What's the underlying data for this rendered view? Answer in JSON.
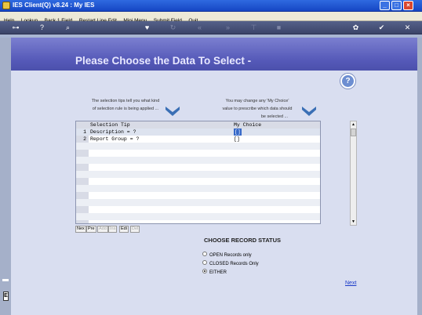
{
  "window": {
    "title": "IES Client(Q) v8.24 : My IES"
  },
  "menu": [
    "Help",
    "Lookup",
    "Back 1 Field",
    "Restart Line Edit",
    "Mini Menu",
    "Submit Field",
    "Quit"
  ],
  "toolbar_icons": [
    "key-icon",
    "help-icon",
    "search-icon",
    "heart-icon",
    "refresh-icon",
    "rewind-icon",
    "fast-forward-icon",
    "tool-icon",
    "stop-icon",
    "settings-icon",
    "check-icon",
    "close-icon"
  ],
  "banner": {
    "heading": "Please Choose the Data To Select -"
  },
  "tips": {
    "left_line1": "The selection tips tell you what kind",
    "left_line2": "of selection rule is being applied ...",
    "right_line1": "You may change any 'My Choice'",
    "right_line2": "value to prescribe which data should",
    "right_line3": "be selected ..."
  },
  "grid": {
    "columns": [
      "Selection Tip",
      "My Choice"
    ],
    "rows": [
      {
        "num": "1",
        "tip": "Description = ?",
        "choice": "[]"
      },
      {
        "num": "2",
        "tip": " Report Group = ?",
        "choice": "[]"
      }
    ],
    "buttons": [
      {
        "label": "Nex",
        "enabled": true
      },
      {
        "label": "Pre",
        "enabled": true
      },
      {
        "label": "Add",
        "enabled": false
      },
      {
        "label": "Ins",
        "enabled": false
      },
      {
        "label": "Edi",
        "enabled": true
      },
      {
        "label": "Del",
        "enabled": false
      }
    ]
  },
  "record_status": {
    "title": "CHOOSE RECORD STATUS",
    "options": [
      "OPEN Records only",
      "CLOSED Records Only",
      "EITHER"
    ],
    "selected": "EITHER"
  },
  "next_link": "Next",
  "colors": {
    "banner": "#5559b8",
    "titlebar": "#1646c4",
    "link": "#1a3ac8"
  }
}
